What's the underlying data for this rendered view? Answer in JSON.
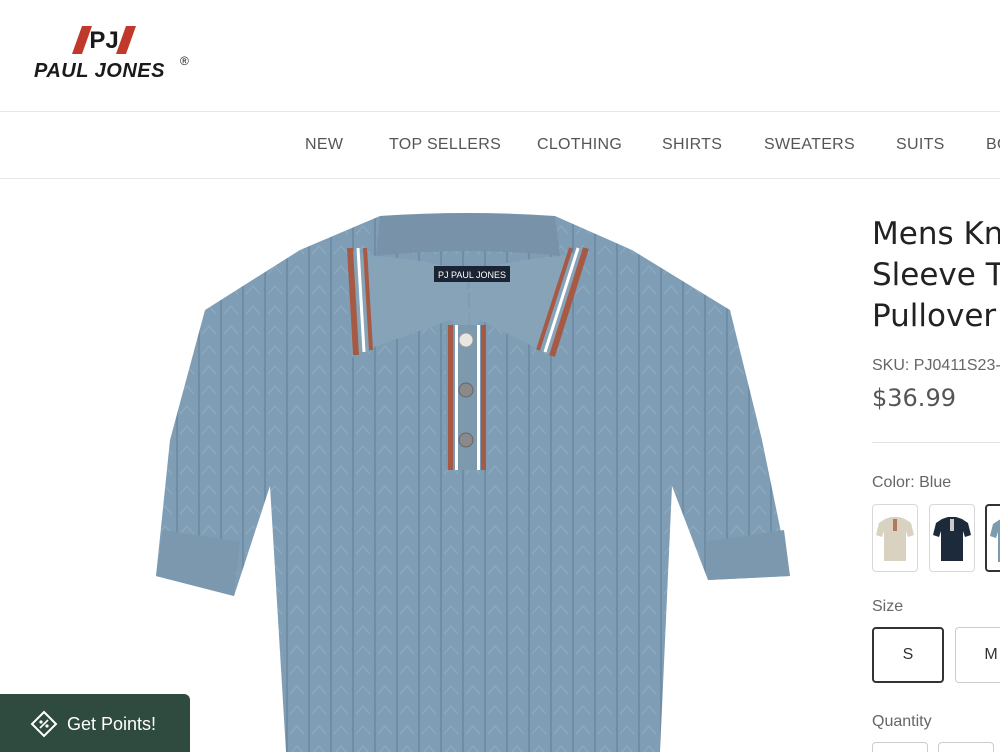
{
  "brand": {
    "monogram": "PJ",
    "name": "PAUL JONES",
    "reg_mark": "®",
    "label_text": "PJ PAUL JONES",
    "accent_color": "#c0392b"
  },
  "nav": {
    "items": [
      {
        "label": "NEW"
      },
      {
        "label": "TOP SELLERS"
      },
      {
        "label": "CLOTHING"
      },
      {
        "label": "SHIRTS"
      },
      {
        "label": "SWEATERS"
      },
      {
        "label": "SUITS"
      },
      {
        "label": "BO"
      }
    ]
  },
  "product": {
    "title": "Mens Kn\nSleeve T\nPullover",
    "sku": "SKU: PJ0411S23-",
    "price": "$36.99",
    "color_label": "Color: Blue",
    "swatches": [
      {
        "name": "beige",
        "color": "#d9d2c0"
      },
      {
        "name": "navy",
        "color": "#1c2a3c"
      },
      {
        "name": "blue",
        "color": "#7d9aae"
      }
    ],
    "size_label": "Size",
    "sizes": [
      {
        "label": "S",
        "selected": true
      },
      {
        "label": "M",
        "selected": false
      }
    ],
    "quantity_label": "Quantity",
    "shirt_color": "#7f9db4",
    "trim_colors": [
      "#a65a45",
      "#ffffff"
    ]
  },
  "rewards": {
    "button_label": "Get Points!",
    "background": "#2f4a3f"
  }
}
